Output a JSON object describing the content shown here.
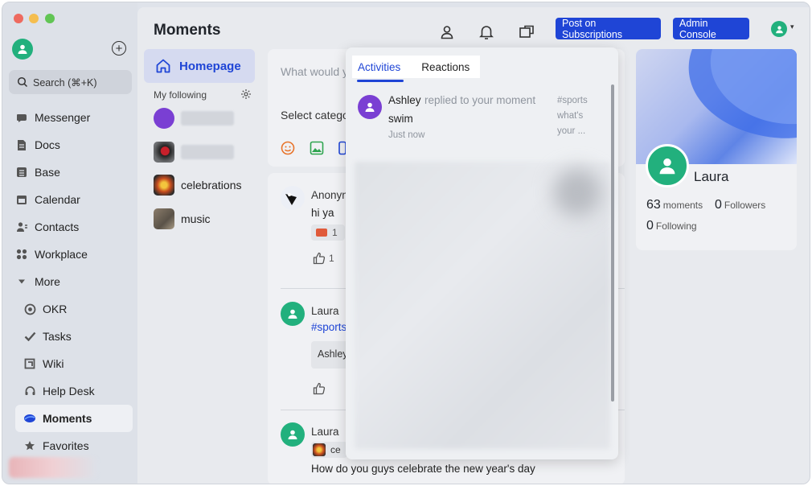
{
  "sidebar": {
    "search_placeholder": "Search (⌘+K)",
    "items": [
      {
        "label": "Messenger",
        "icon": "chat-icon"
      },
      {
        "label": "Docs",
        "icon": "docs-icon"
      },
      {
        "label": "Base",
        "icon": "base-icon"
      },
      {
        "label": "Calendar",
        "icon": "calendar-icon"
      },
      {
        "label": "Contacts",
        "icon": "contacts-icon"
      },
      {
        "label": "Workplace",
        "icon": "workplace-icon"
      },
      {
        "label": "More",
        "icon": "caret-down-icon"
      },
      {
        "label": "OKR",
        "icon": "okr-icon"
      },
      {
        "label": "Tasks",
        "icon": "tasks-icon"
      },
      {
        "label": "Wiki",
        "icon": "wiki-icon"
      },
      {
        "label": "Help Desk",
        "icon": "help-desk-icon"
      },
      {
        "label": "Moments",
        "icon": "moments-icon"
      },
      {
        "label": "Favorites",
        "icon": "star-icon"
      }
    ]
  },
  "header": {
    "title": "Moments",
    "post_button": "Post on Subscriptions",
    "admin_button": "Admin Console"
  },
  "left": {
    "homepage": "Homepage",
    "my_following": "My following",
    "following": [
      "celebrations",
      "music"
    ]
  },
  "composer": {
    "placeholder": "What would y",
    "category": "Select catego"
  },
  "posts": [
    {
      "author": "Anonyn",
      "text": "hi ya",
      "reaction_count": "1",
      "like_count": "1"
    },
    {
      "author": "Laura",
      "text": "#sports",
      "quote": "Ashley"
    },
    {
      "author": "Laura",
      "tag": "ce",
      "text": "How do you guys celebrate the new year's day"
    }
  ],
  "notifications": {
    "tabs": [
      "Activities",
      "Reactions"
    ],
    "activity": {
      "user": "Ashley",
      "verb": "replied to your moment",
      "text": "swim",
      "time": "Just now",
      "snippet": [
        "#sports",
        "what's",
        "your ..."
      ]
    }
  },
  "profile": {
    "name": "Laura",
    "moments": "63",
    "moments_label": "moments",
    "followers": "0",
    "followers_label": "Followers",
    "following": "0",
    "following_label": "Following"
  },
  "colors": {
    "accent": "#1f45d6",
    "avatar_green": "#22b07d",
    "avatar_purple": "#7a3fd3"
  }
}
